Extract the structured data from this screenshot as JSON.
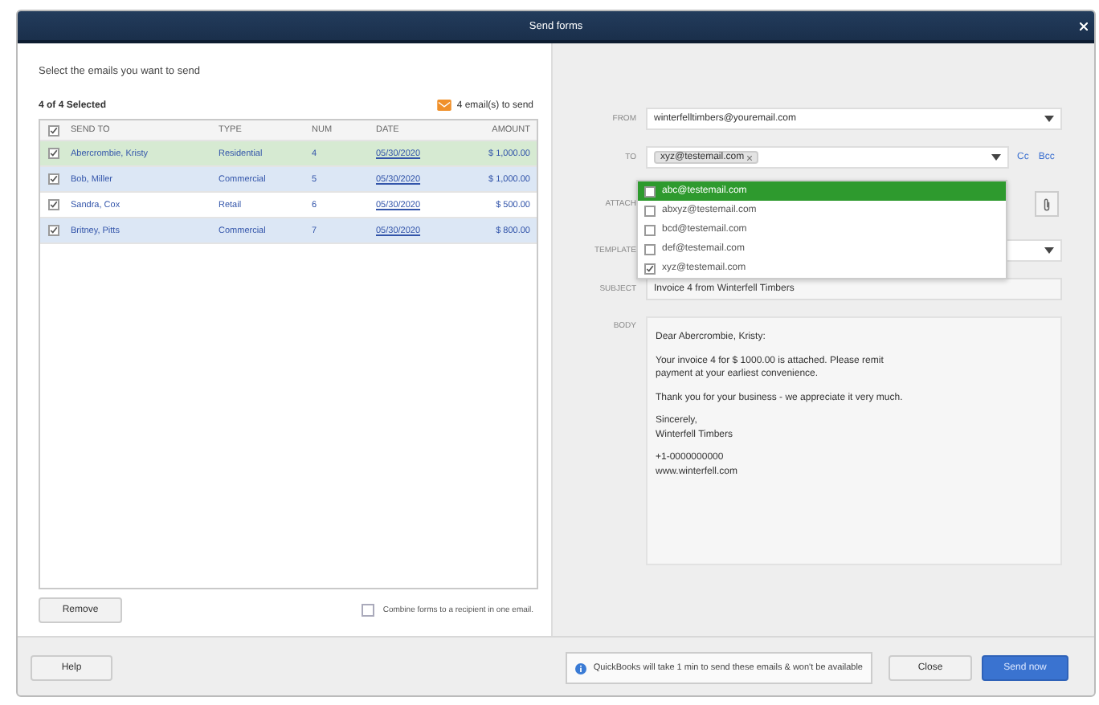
{
  "window": {
    "title": "Send forms"
  },
  "left": {
    "heading": "Select the emails you want to send",
    "count": "4 of 4 Selected",
    "to_send": "4 email(s) to send",
    "table": {
      "all_checked": true,
      "columns": [
        "SEND TO",
        "TYPE",
        "NUM",
        "DATE",
        "AMOUNT"
      ],
      "rows": [
        {
          "cells": [
            "Abercrombie, Kristy",
            "Residential",
            "4",
            "05/30/2020",
            "$ 1,000.00"
          ],
          "checked": true,
          "selected": true
        },
        {
          "cells": [
            "Bob, Miller",
            "Commercial",
            "5",
            "05/30/2020",
            "$ 1,000.00"
          ],
          "checked": true,
          "selected": false
        },
        {
          "cells": [
            "Sandra, Cox",
            "Retail",
            "6",
            "05/30/2020",
            "$ 500.00"
          ],
          "checked": true,
          "selected": false
        },
        {
          "cells": [
            "Britney, Pitts",
            "Commercial",
            "7",
            "05/30/2020",
            "$ 800.00"
          ],
          "checked": true,
          "selected": false
        }
      ]
    },
    "remove_button": "Remove",
    "combine": {
      "label": "Combine forms to a recipient in one email.",
      "checked": false
    }
  },
  "form": {
    "from": {
      "label": "FROM",
      "value": "winterfelltimbers@youremail.com"
    },
    "to": {
      "label": "TO",
      "chips": [
        "xyz@testemail.com"
      ],
      "cc": "Cc",
      "bcc": "Bcc"
    },
    "recipient_options": [
      {
        "email": "abc@testemail.com",
        "checked": false,
        "selected": true
      },
      {
        "email": "abxyz@testemail.com",
        "checked": false,
        "selected": false
      },
      {
        "email": "bcd@testemail.com",
        "checked": false,
        "selected": false
      },
      {
        "email": "def@testemail.com",
        "checked": false,
        "selected": false
      },
      {
        "email": "xyz@testemail.com",
        "checked": true,
        "selected": false
      }
    ],
    "attach_label": "ATTACH",
    "template_label": "TEMPLATE",
    "subject": {
      "label": "SUBJECT",
      "value": "Invoice 4 from Winterfell Timbers"
    },
    "body": {
      "label": "BODY",
      "paragraphs": [
        [
          "Dear Abercrombie, Kristy:"
        ],
        [
          "Your invoice 4 for $ 1000.00 is attached. Please remit",
          "payment at your earliest convenience."
        ],
        [
          "Thank you for your business - we appreciate it very much."
        ],
        [
          "Sincerely,",
          "Winterfell Timbers"
        ],
        [
          "+1-0000000000",
          "www.winterfell.com"
        ]
      ]
    }
  },
  "footer": {
    "help": "Help",
    "info": "QuickBooks will take 1 min to send these emails & won't be available",
    "close": "Close",
    "send": "Send now"
  }
}
